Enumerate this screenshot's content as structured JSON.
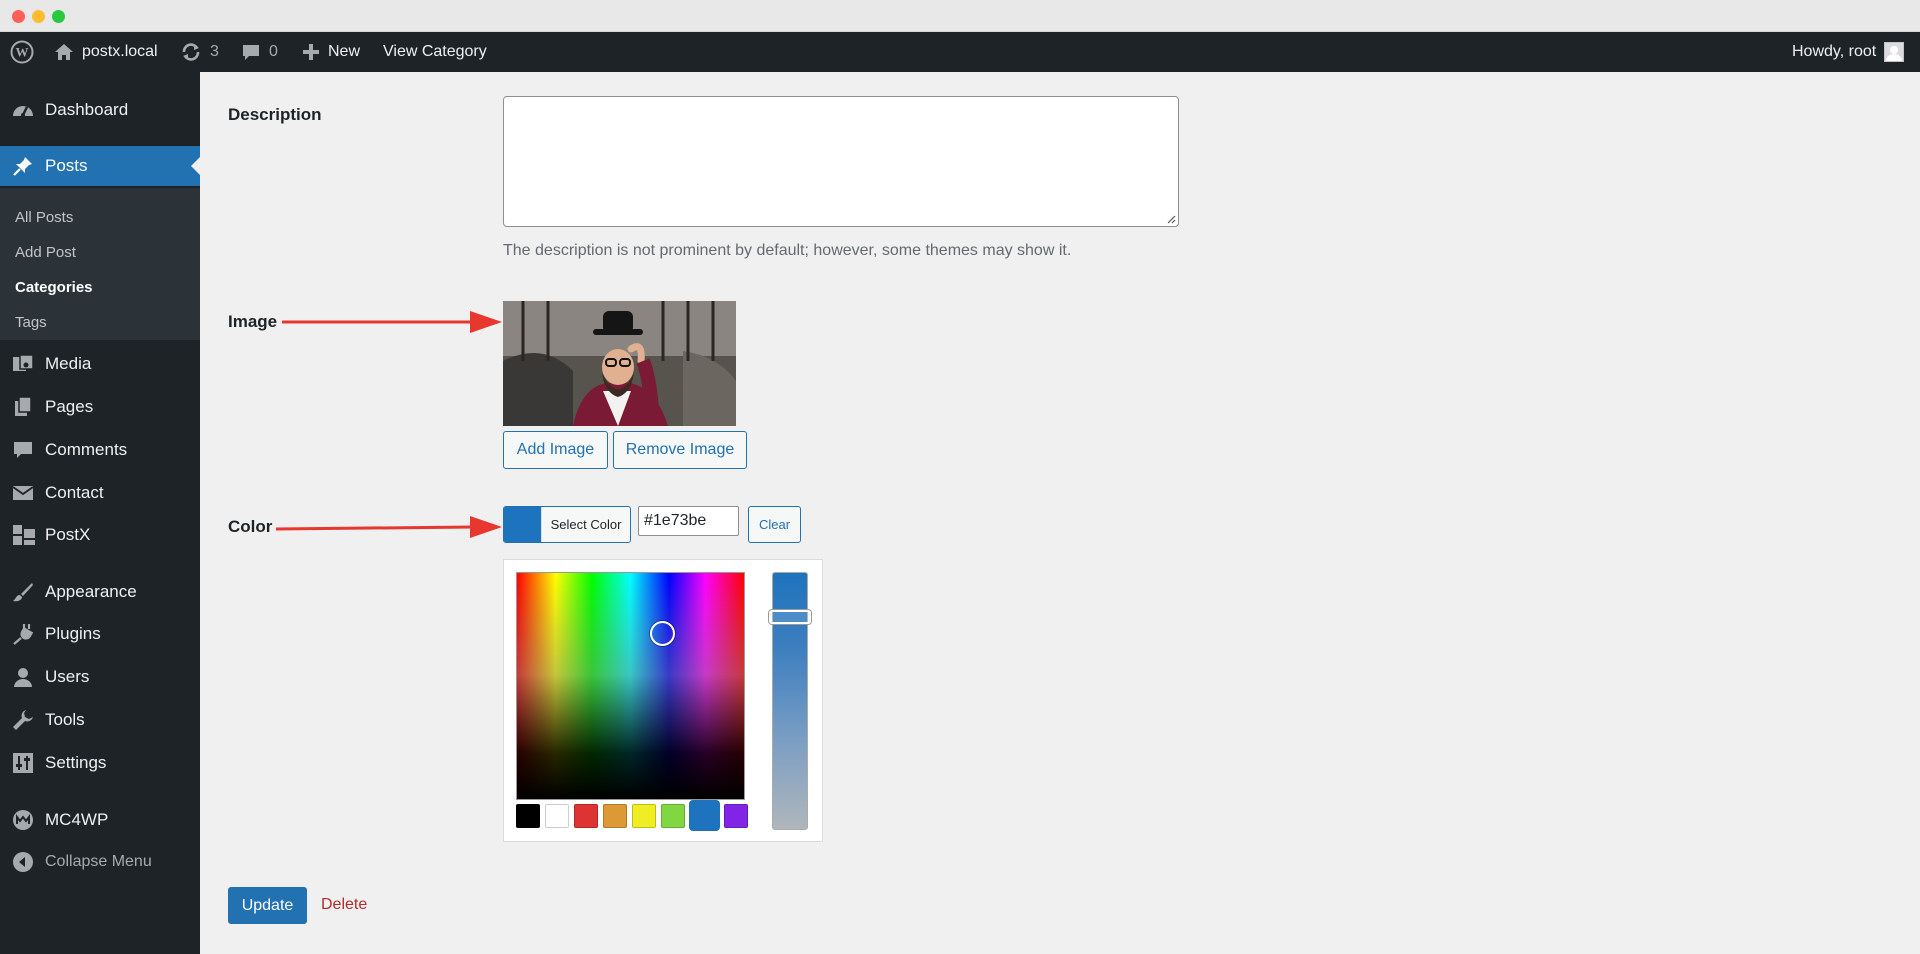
{
  "admin_bar": {
    "site_name": "postx.local",
    "updates_count": "3",
    "comments_count": "0",
    "new_label": "New",
    "view_link": "View Category",
    "greeting": "Howdy, root"
  },
  "sidebar": {
    "items": [
      {
        "label": "Dashboard",
        "icon": "dashboard-icon"
      },
      {
        "label": "Posts",
        "icon": "pin-icon"
      },
      {
        "label": "Media",
        "icon": "media-icon"
      },
      {
        "label": "Pages",
        "icon": "pages-icon"
      },
      {
        "label": "Comments",
        "icon": "comment-icon"
      },
      {
        "label": "Contact",
        "icon": "mail-icon"
      },
      {
        "label": "PostX",
        "icon": "postx-icon"
      },
      {
        "label": "Appearance",
        "icon": "brush-icon"
      },
      {
        "label": "Plugins",
        "icon": "plug-icon"
      },
      {
        "label": "Users",
        "icon": "user-icon"
      },
      {
        "label": "Tools",
        "icon": "wrench-icon"
      },
      {
        "label": "Settings",
        "icon": "sliders-icon"
      },
      {
        "label": "MC4WP",
        "icon": "mc4wp-icon"
      }
    ],
    "submenu": [
      "All Posts",
      "Add Post",
      "Categories",
      "Tags"
    ],
    "collapse_label": "Collapse Menu"
  },
  "form": {
    "description_label": "Description",
    "description_value": "",
    "description_hint": "The description is not prominent by default; however, some themes may show it.",
    "image_label": "Image",
    "add_image": "Add Image",
    "remove_image": "Remove Image",
    "color_label": "Color",
    "select_color": "Select Color",
    "color_value": "#1e73be",
    "clear": "Clear",
    "palette": [
      "#000000",
      "#ffffff",
      "#dd3333",
      "#dd9933",
      "#eeee22",
      "#81d742",
      "#1e73be",
      "#8224e3"
    ],
    "update": "Update",
    "delete": "Delete"
  },
  "colors": {
    "admin_bg": "#1d2327",
    "accent": "#2271b1",
    "delete": "#b32d2e",
    "annotation": "#e8372e"
  }
}
